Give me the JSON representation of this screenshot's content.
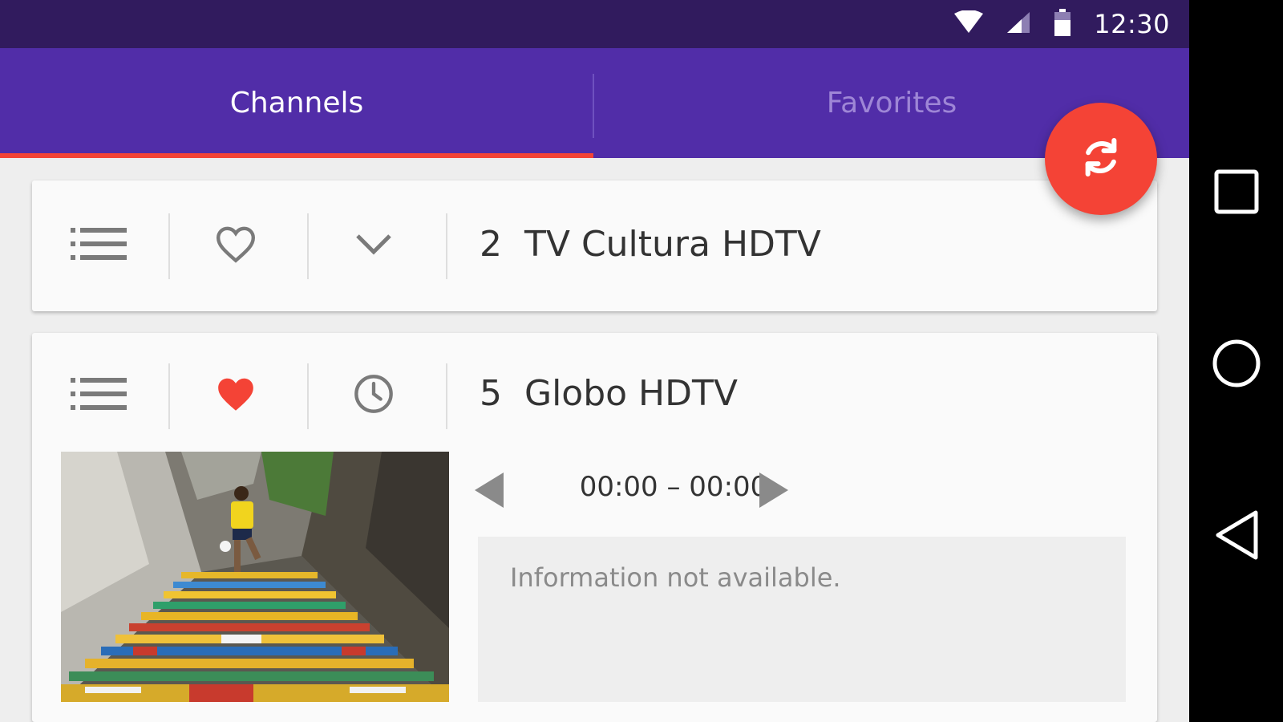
{
  "status_bar": {
    "time": "12:30",
    "icons": [
      "wifi-icon",
      "cell-signal-icon",
      "battery-icon"
    ]
  },
  "tabs": [
    {
      "label": "Channels",
      "selected": true
    },
    {
      "label": "Favorites",
      "selected": false
    }
  ],
  "fab": {
    "icon": "refresh-icon"
  },
  "channels": [
    {
      "number": "2",
      "name": "TV Cultura HDTV",
      "favorite": false,
      "icons": [
        "list-icon",
        "heart-outline-icon",
        "chevron-down-icon"
      ]
    },
    {
      "number": "5",
      "name": "Globo HDTV",
      "favorite": true,
      "icons": [
        "list-icon",
        "heart-filled-icon",
        "clock-icon"
      ],
      "program": {
        "time_range": "00:00 – 00:00",
        "info": "Information not available."
      }
    }
  ],
  "nav_bar": {
    "icons": [
      "recents-icon",
      "home-icon",
      "back-icon"
    ]
  },
  "colors": {
    "status_bar": "#311b5e",
    "primary": "#512da8",
    "accent": "#f44336",
    "inactive_tab_text": "#9e86d6"
  }
}
